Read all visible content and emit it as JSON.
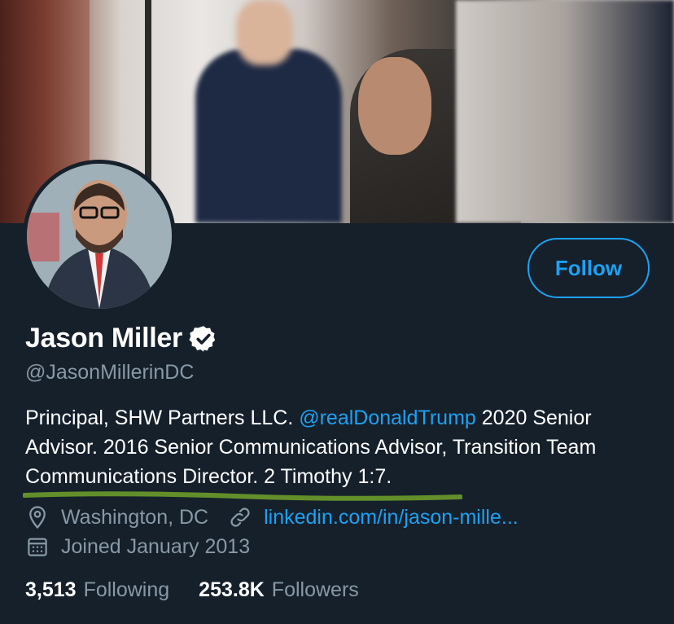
{
  "profile": {
    "name": "Jason Miller",
    "handle": "@JasonMillerinDC",
    "verified": true,
    "follow_label": "Follow",
    "bio_part1": "Principal, SHW Partners LLC. ",
    "bio_mention": "@realDonaldTrump",
    "bio_part2": " 2020 Senior Advisor. 2016 Senior Communications Advisor, Transition Team Communications Director. 2 Timothy 1:7.",
    "location": "Washington, DC",
    "website": "linkedin.com/in/jason-mille...",
    "joined": "Joined January 2013",
    "following_count": "3,513",
    "following_label": "Following",
    "followers_count": "253.8K",
    "followers_label": "Followers"
  },
  "colors": {
    "background": "#15202b",
    "accent": "#1da1f2",
    "secondary_text": "#8899a6",
    "annotation_underline": "#6b9b2a"
  },
  "icons": [
    "verified-badge-icon",
    "location-pin-icon",
    "link-icon",
    "calendar-icon"
  ]
}
